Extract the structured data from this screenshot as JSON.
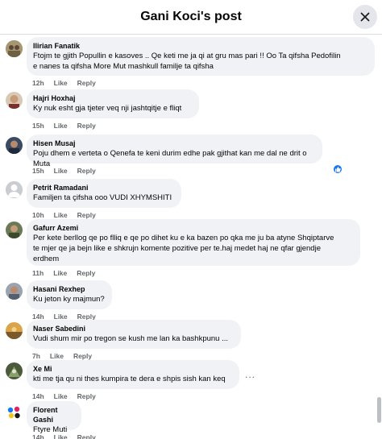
{
  "header": {
    "title": "Gani Koci's post"
  },
  "labels": {
    "like": "Like",
    "reply": "Reply",
    "more": "..."
  },
  "comments": [
    {
      "author": "Ilirian Fanatik",
      "lines": [
        "Ftojm te gjith Popullin e kasoves .. Qe keti me ja qi at gru mas pari !! Oo Ta qifsha Pedofilin",
        "e nanes ta qifsha More Mut mashkull familje ta qifsha"
      ],
      "time": "12h"
    },
    {
      "author": "Hajri Hoxhaj",
      "lines": [
        "Ky nuk esht gja tjeter veq nji jashtqitje e fliqt"
      ],
      "time": "15h"
    },
    {
      "author": "Hisen Musaj",
      "lines": [
        "Poju dhem e verteta o Qenefa te keni durim edhe pak gjithat kan me dal ne drit o Muta"
      ],
      "time": "15h"
    },
    {
      "author": "Petrit Ramadani",
      "lines": [
        "Familjen ta çifsha ooo VUDI XHYMSHITI"
      ],
      "time": "10h"
    },
    {
      "author": "Gafurr Azemi",
      "lines": [
        "Per kete berllog qe po flliq e qe po dihet ku e ka bazen po qka me ju ba atyne Shqiptarve",
        "te mjer qe ja bejn like e shkrujn komente pozitive per te.haj medet haj ne qfar gjendje",
        "erdhem"
      ],
      "time": "11h"
    },
    {
      "author": "Hasani Rexhep",
      "lines": [
        "Ku jeton ky majmun?"
      ],
      "time": "14h"
    },
    {
      "author": "Naser Sabedini",
      "lines": [
        "Vudi shum mir po tregon se kush me lan ka bashkpunu ..."
      ],
      "time": "7h"
    },
    {
      "author": "Xe Mi",
      "lines": [
        "kti me tja qu ni thes kumpira te dera e shpis sish kan keq"
      ],
      "time": "14h"
    },
    {
      "author": "Florent Gashi",
      "lines": [
        "Ftyre Muti"
      ],
      "time": "14h"
    }
  ]
}
